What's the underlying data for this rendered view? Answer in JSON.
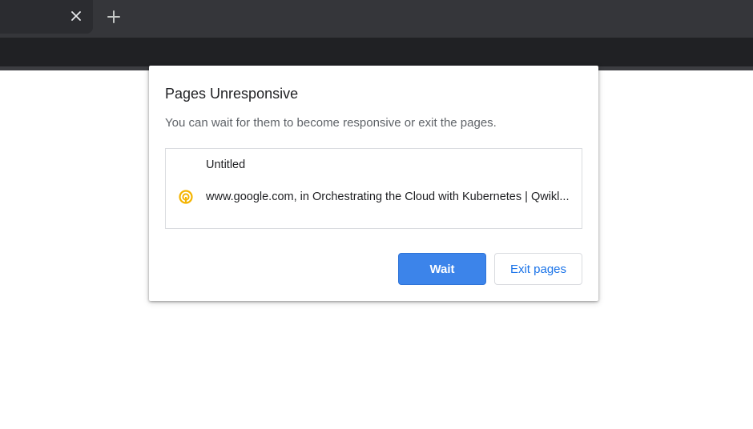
{
  "browser": {
    "tabstrip": {
      "close_icon": "close-icon",
      "new_tab_icon": "plus-icon"
    }
  },
  "dialog": {
    "title": "Pages Unresponsive",
    "message": "You can wait for them to become responsive or exit the pages.",
    "pages": [
      {
        "label": "Untitled",
        "favicon": ""
      },
      {
        "label": "www.google.com, in Orchestrating the Cloud with Kubernetes | Qwikl...",
        "favicon": "qwiklabs-icon"
      }
    ],
    "buttons": {
      "wait_label": "Wait",
      "exit_label": "Exit pages"
    },
    "colors": {
      "primary_button": "#3c84ea",
      "link_text": "#1a73e8",
      "favicon": "#f4b400"
    }
  }
}
